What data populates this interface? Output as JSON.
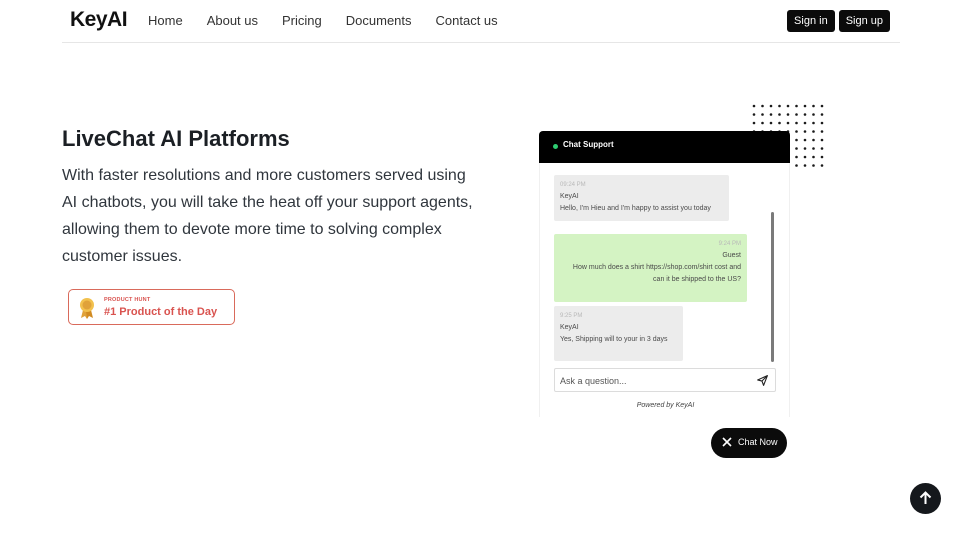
{
  "header": {
    "logo": "KeyAI",
    "nav": [
      "Home",
      "About us",
      "Pricing",
      "Documents",
      "Contact us"
    ],
    "sign_in": "Sign in",
    "sign_up": "Sign up"
  },
  "hero": {
    "title": "LiveChat AI Platforms",
    "description": "With faster resolutions and more customers served using AI chatbots, you will take the heat off your support agents, allowing them to devote more time to solving complex customer issues.",
    "badge": {
      "small": "PRODUCT HUNT",
      "big": "#1 Product of the Day",
      "icon": "medal-icon"
    }
  },
  "chat": {
    "header_title": "Chat Support",
    "messages": [
      {
        "meta": "09:24 PM",
        "sender": "KeyAI",
        "text": "Hello, I'm Hieu and I'm happy to assist you today"
      },
      {
        "meta": "9:24 PM",
        "sender": "Guest",
        "text": "How much does a shirt https://shop.com/shirt cost and can it be shipped to the US?"
      },
      {
        "meta": "9:25 PM",
        "sender": "KeyAI",
        "text": "Yes, Shipping will to your in 3 days"
      }
    ],
    "input_placeholder": "Ask a question...",
    "powered_by": "Powered by KeyAI",
    "chat_now": "Chat Now"
  },
  "colors": {
    "accent_dark": "#0b0b0b",
    "badge_red": "#d9534f",
    "guest_bubble": "#d4f3c3",
    "online_dot": "#2ecc71"
  },
  "icons": [
    "send-icon",
    "close-icon",
    "arrow-up-icon",
    "medal-icon"
  ]
}
